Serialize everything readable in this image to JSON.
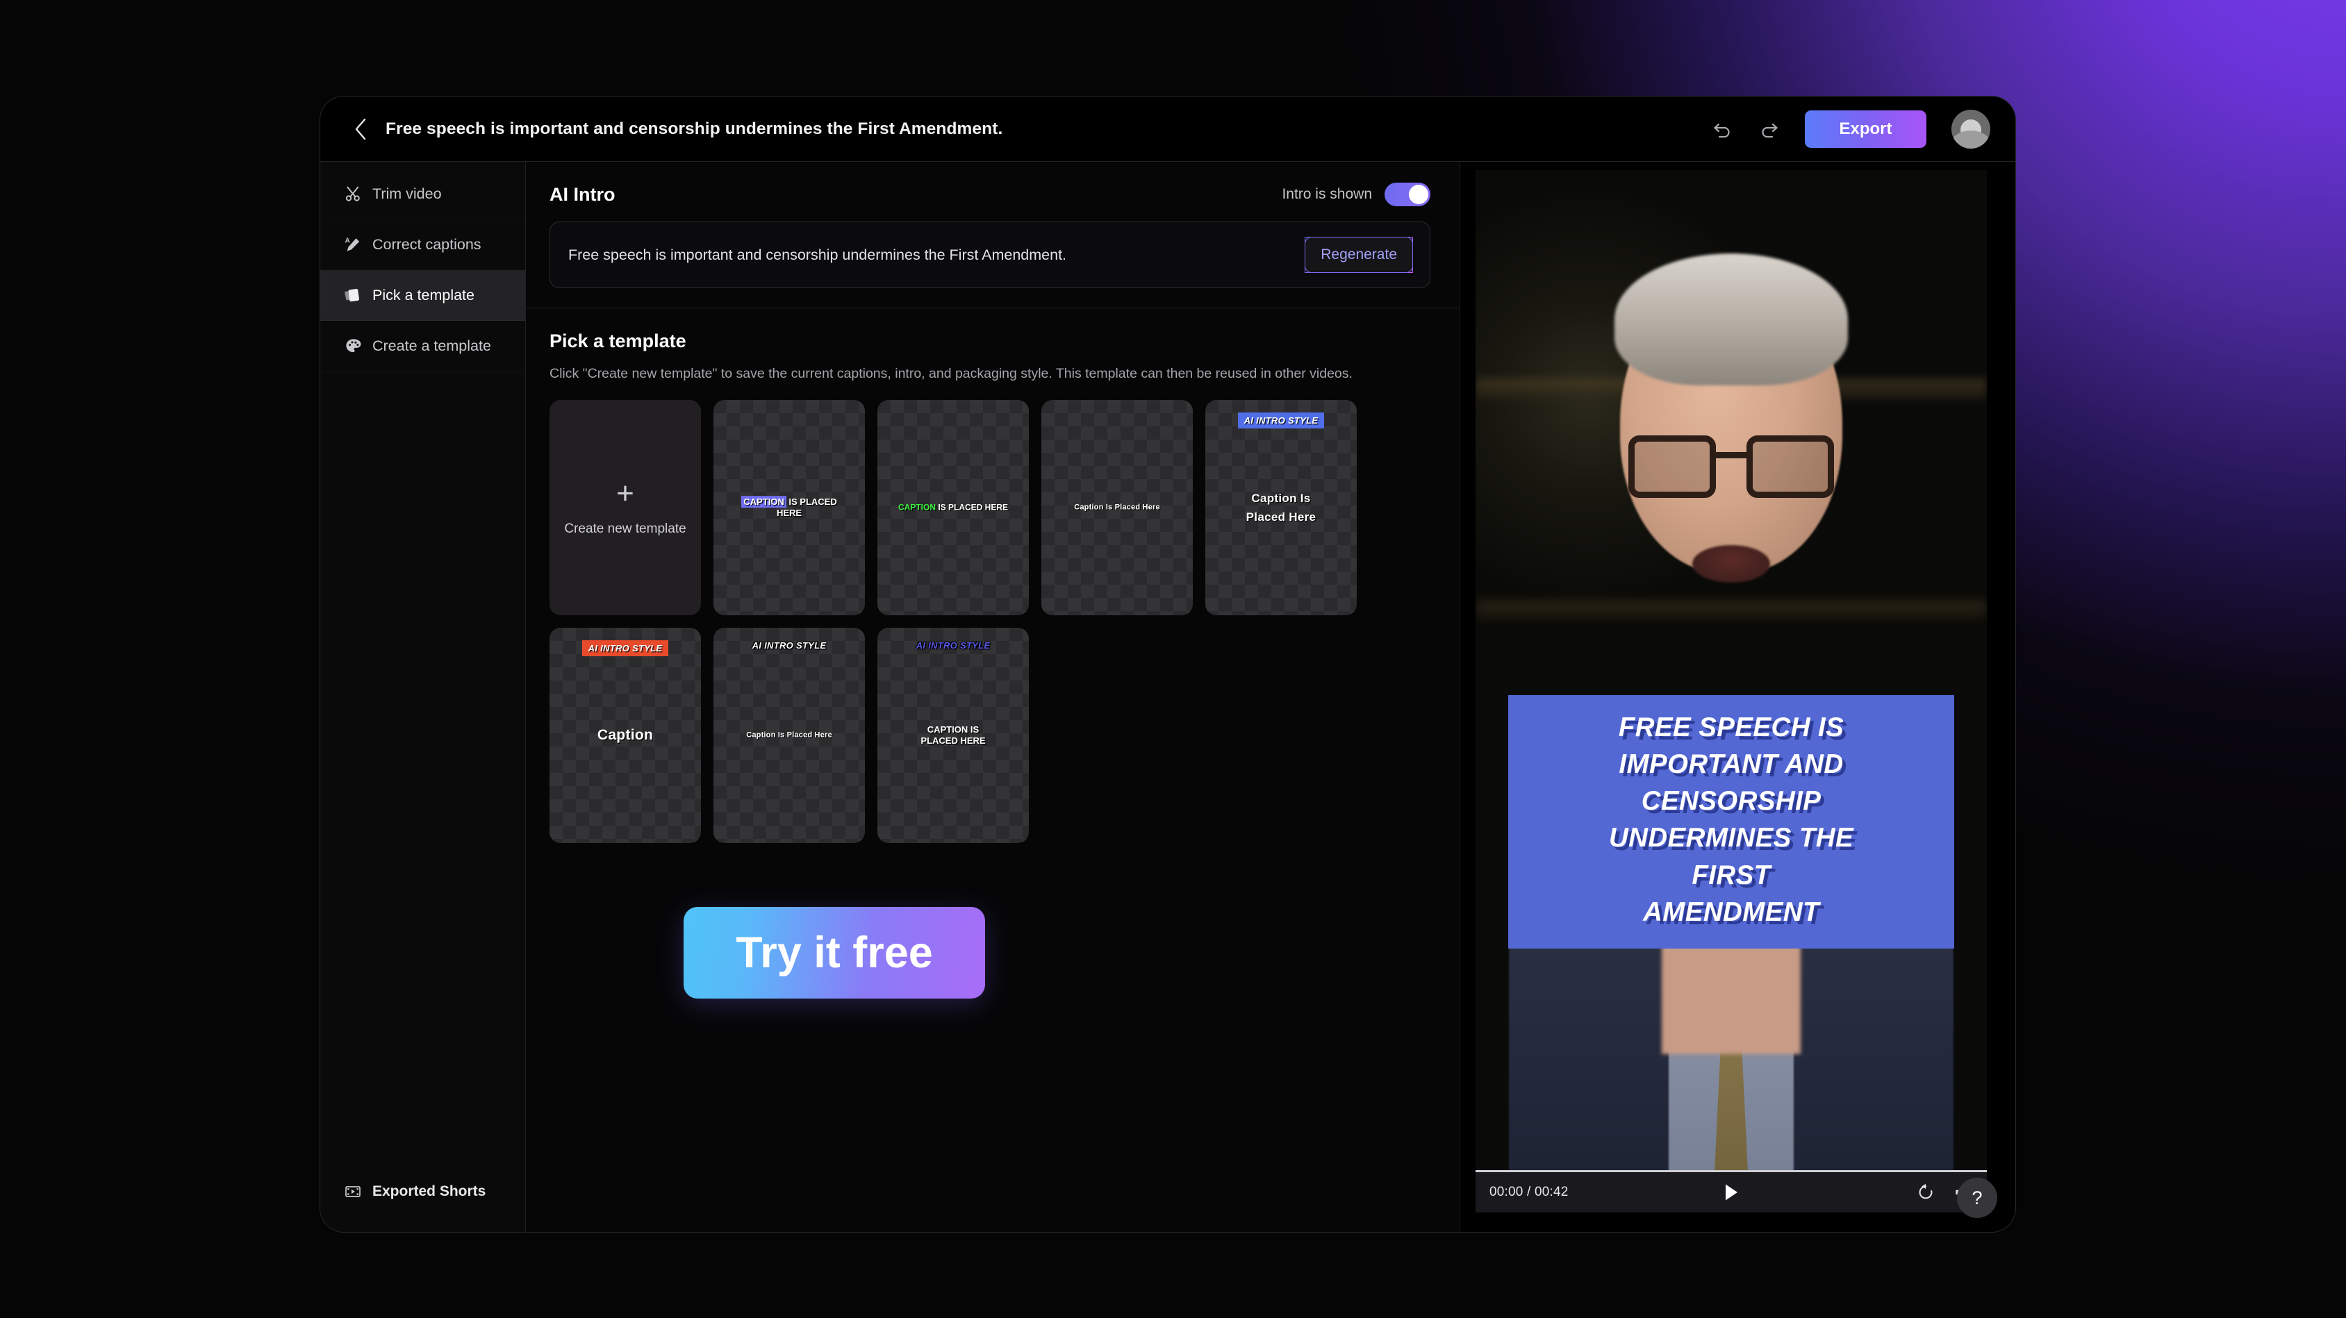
{
  "window": {
    "doc_title": "Free speech is important and censorship undermines the First Amendment.",
    "back_icon": "chevron-left-icon",
    "undo_icon": "undo-icon",
    "redo_icon": "redo-icon",
    "export_label": "Export",
    "avatar_name": "user-avatar"
  },
  "sidebar": {
    "items": [
      {
        "label": "Trim video",
        "icon": "scissors-icon",
        "active": false
      },
      {
        "label": "Correct captions",
        "icon": "text-edit-pen-icon",
        "active": false
      },
      {
        "label": "Pick a template",
        "icon": "cards-stack-icon",
        "active": true
      },
      {
        "label": "Create a template",
        "icon": "palette-icon",
        "active": false
      }
    ],
    "bottom": {
      "label": "Exported Shorts",
      "icon": "film-strip-icon"
    }
  },
  "ai_intro": {
    "title": "AI Intro",
    "toggle_label": "Intro is shown",
    "toggle_on": true,
    "intro_text": "Free speech is important and censorship undermines the First Amendment.",
    "regenerate_label": "Regenerate"
  },
  "templates": {
    "section_title": "Pick a template",
    "section_subtitle": "Click \"Create new template\" to save the current captions, intro, and packaging style. This template can then be reused in other videos.",
    "create_card": {
      "label": "Create new template",
      "icon": "plus-icon"
    },
    "cards": [
      {
        "id": "tpl-1",
        "intro_badge": null,
        "caption_lines": [
          "CAPTION IS PLACED",
          "HERE"
        ],
        "caption_size": 13,
        "caption_style": "bold-uppercase",
        "highlight_word": "CAPTION",
        "highlight_bg": "#6f6df0",
        "caption_color": "#ffffff"
      },
      {
        "id": "tpl-2",
        "intro_badge": null,
        "caption_lines": [
          "CAPTION IS PLACED HERE"
        ],
        "caption_size": 12,
        "caption_style": "bold-uppercase",
        "highlight_word": "CAPTION",
        "highlight_color": "#3ef23e",
        "caption_color": "#ffffff"
      },
      {
        "id": "tpl-3",
        "intro_badge": null,
        "caption_lines": [
          "Caption Is Placed Here"
        ],
        "caption_size": 11,
        "caption_style": "condensed",
        "caption_color": "#ffffff"
      },
      {
        "id": "tpl-4",
        "intro_badge": {
          "text": "AI INTRO STYLE",
          "bg": "#4f6ee8",
          "color": "#ffffff"
        },
        "caption_lines": [
          "Caption  Is",
          "Placed  Here"
        ],
        "caption_size": 17,
        "caption_style": "rounded",
        "caption_color": "#ffffff"
      },
      {
        "id": "tpl-5",
        "intro_badge": {
          "text": "AI INTRO STYLE",
          "bg": "#e84b2c",
          "color": "#ffffff"
        },
        "caption_lines": [
          "Caption"
        ],
        "caption_size": 21,
        "caption_style": "rounded",
        "caption_color": "#ffffff"
      },
      {
        "id": "tpl-6",
        "intro_badge": {
          "text": "AI INTRO STYLE",
          "bg": "transparent",
          "color": "#ffffff"
        },
        "caption_lines": [
          "Caption Is Placed Here"
        ],
        "caption_size": 11,
        "caption_style": "condensed",
        "caption_color": "#ffffff"
      },
      {
        "id": "tpl-7",
        "intro_badge": {
          "text": "AI INTRO STYLE",
          "bg": "transparent",
          "color": "#5a5ae8"
        },
        "caption_lines": [
          "CAPTION  IS",
          "PLACED  HERE"
        ],
        "caption_size": 13,
        "caption_style": "bold-uppercase",
        "caption_color": "#ffffff"
      }
    ]
  },
  "cta": {
    "label": "Try it free"
  },
  "preview": {
    "caption_lines": [
      "FREE SPEECH IS",
      "IMPORTANT AND",
      "CENSORSHIP",
      "UNDERMINES THE",
      "FIRST",
      "AMENDMENT"
    ],
    "caption_bg": "#5468d4",
    "caption_shadow": "#2c3b96",
    "player": {
      "current_time": "00:00",
      "duration": "00:42",
      "time_display": "00:00 / 00:42",
      "play_icon": "play-icon",
      "replay_icon": "replay-icon",
      "volume_icon": "volume-icon"
    }
  },
  "help": {
    "label": "?",
    "icon": "question-mark-icon"
  },
  "colors": {
    "accent_purple": "#7b3ff2",
    "export_gradient_start": "#5b7cfa",
    "export_gradient_end": "#a855f7",
    "cta_gradient_start": "#4fc3f7",
    "cta_gradient_end": "#a86cf7"
  }
}
